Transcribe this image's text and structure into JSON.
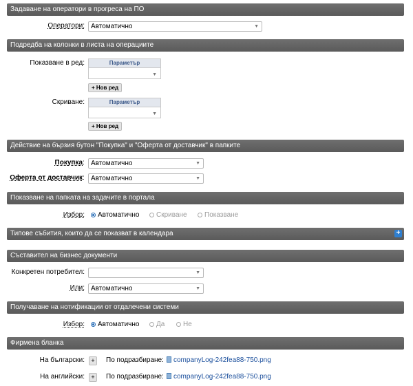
{
  "sections": {
    "s1": "Задаване на оператори в прогреса на ПО",
    "s2": "Подредба на колонки в листа на операциите",
    "s3": "Действие на бързия бутон \"Покупка\" и \"Оферта от доставчик\" в папките",
    "s4": "Показване на папката на задачите в портала",
    "s5": "Типове събития, които да се показват в календара",
    "s6": "Съставител на бизнес документи",
    "s7": "Получаване на нотификации от отдалечени системи",
    "s8": "Фирмена бланка"
  },
  "operators": {
    "label": "Оператори:",
    "value": "Автоматично"
  },
  "columns": {
    "show_label": "Показване в ред:",
    "hide_label": "Скриване:",
    "grid_header": "Параметър",
    "add_label": "+ Нов ред"
  },
  "quick": {
    "purchase_label": "Покупка",
    "purchase_value": "Автоматично",
    "offer_label": "Оферта от доставчик",
    "offer_value": "Автоматично"
  },
  "portal": {
    "label": "Избор:",
    "options": [
      "Автоматично",
      "Скриване",
      "Показване"
    ],
    "selected": 0
  },
  "composer": {
    "user_label": "Конкретен потребител:",
    "user_value": "",
    "or_label": "Или:",
    "or_value": "Автоматично"
  },
  "notif": {
    "label": "Избор:",
    "options": [
      "Автоматично",
      "Да",
      "Не"
    ],
    "selected": 0
  },
  "letterhead": {
    "bg_label": "На български:",
    "en_label": "На английски:",
    "plus": "+",
    "default_label": "По подразбиране:",
    "file": "companyLog-242fea88-750.png"
  },
  "icons": {
    "expand": "plus-square-icon",
    "file": "image-file-icon",
    "radio": "radio-icon"
  },
  "colors": {
    "section_bg": "#5f5f5f",
    "accent": "#2f7fd0",
    "link": "#1b4f9c"
  }
}
